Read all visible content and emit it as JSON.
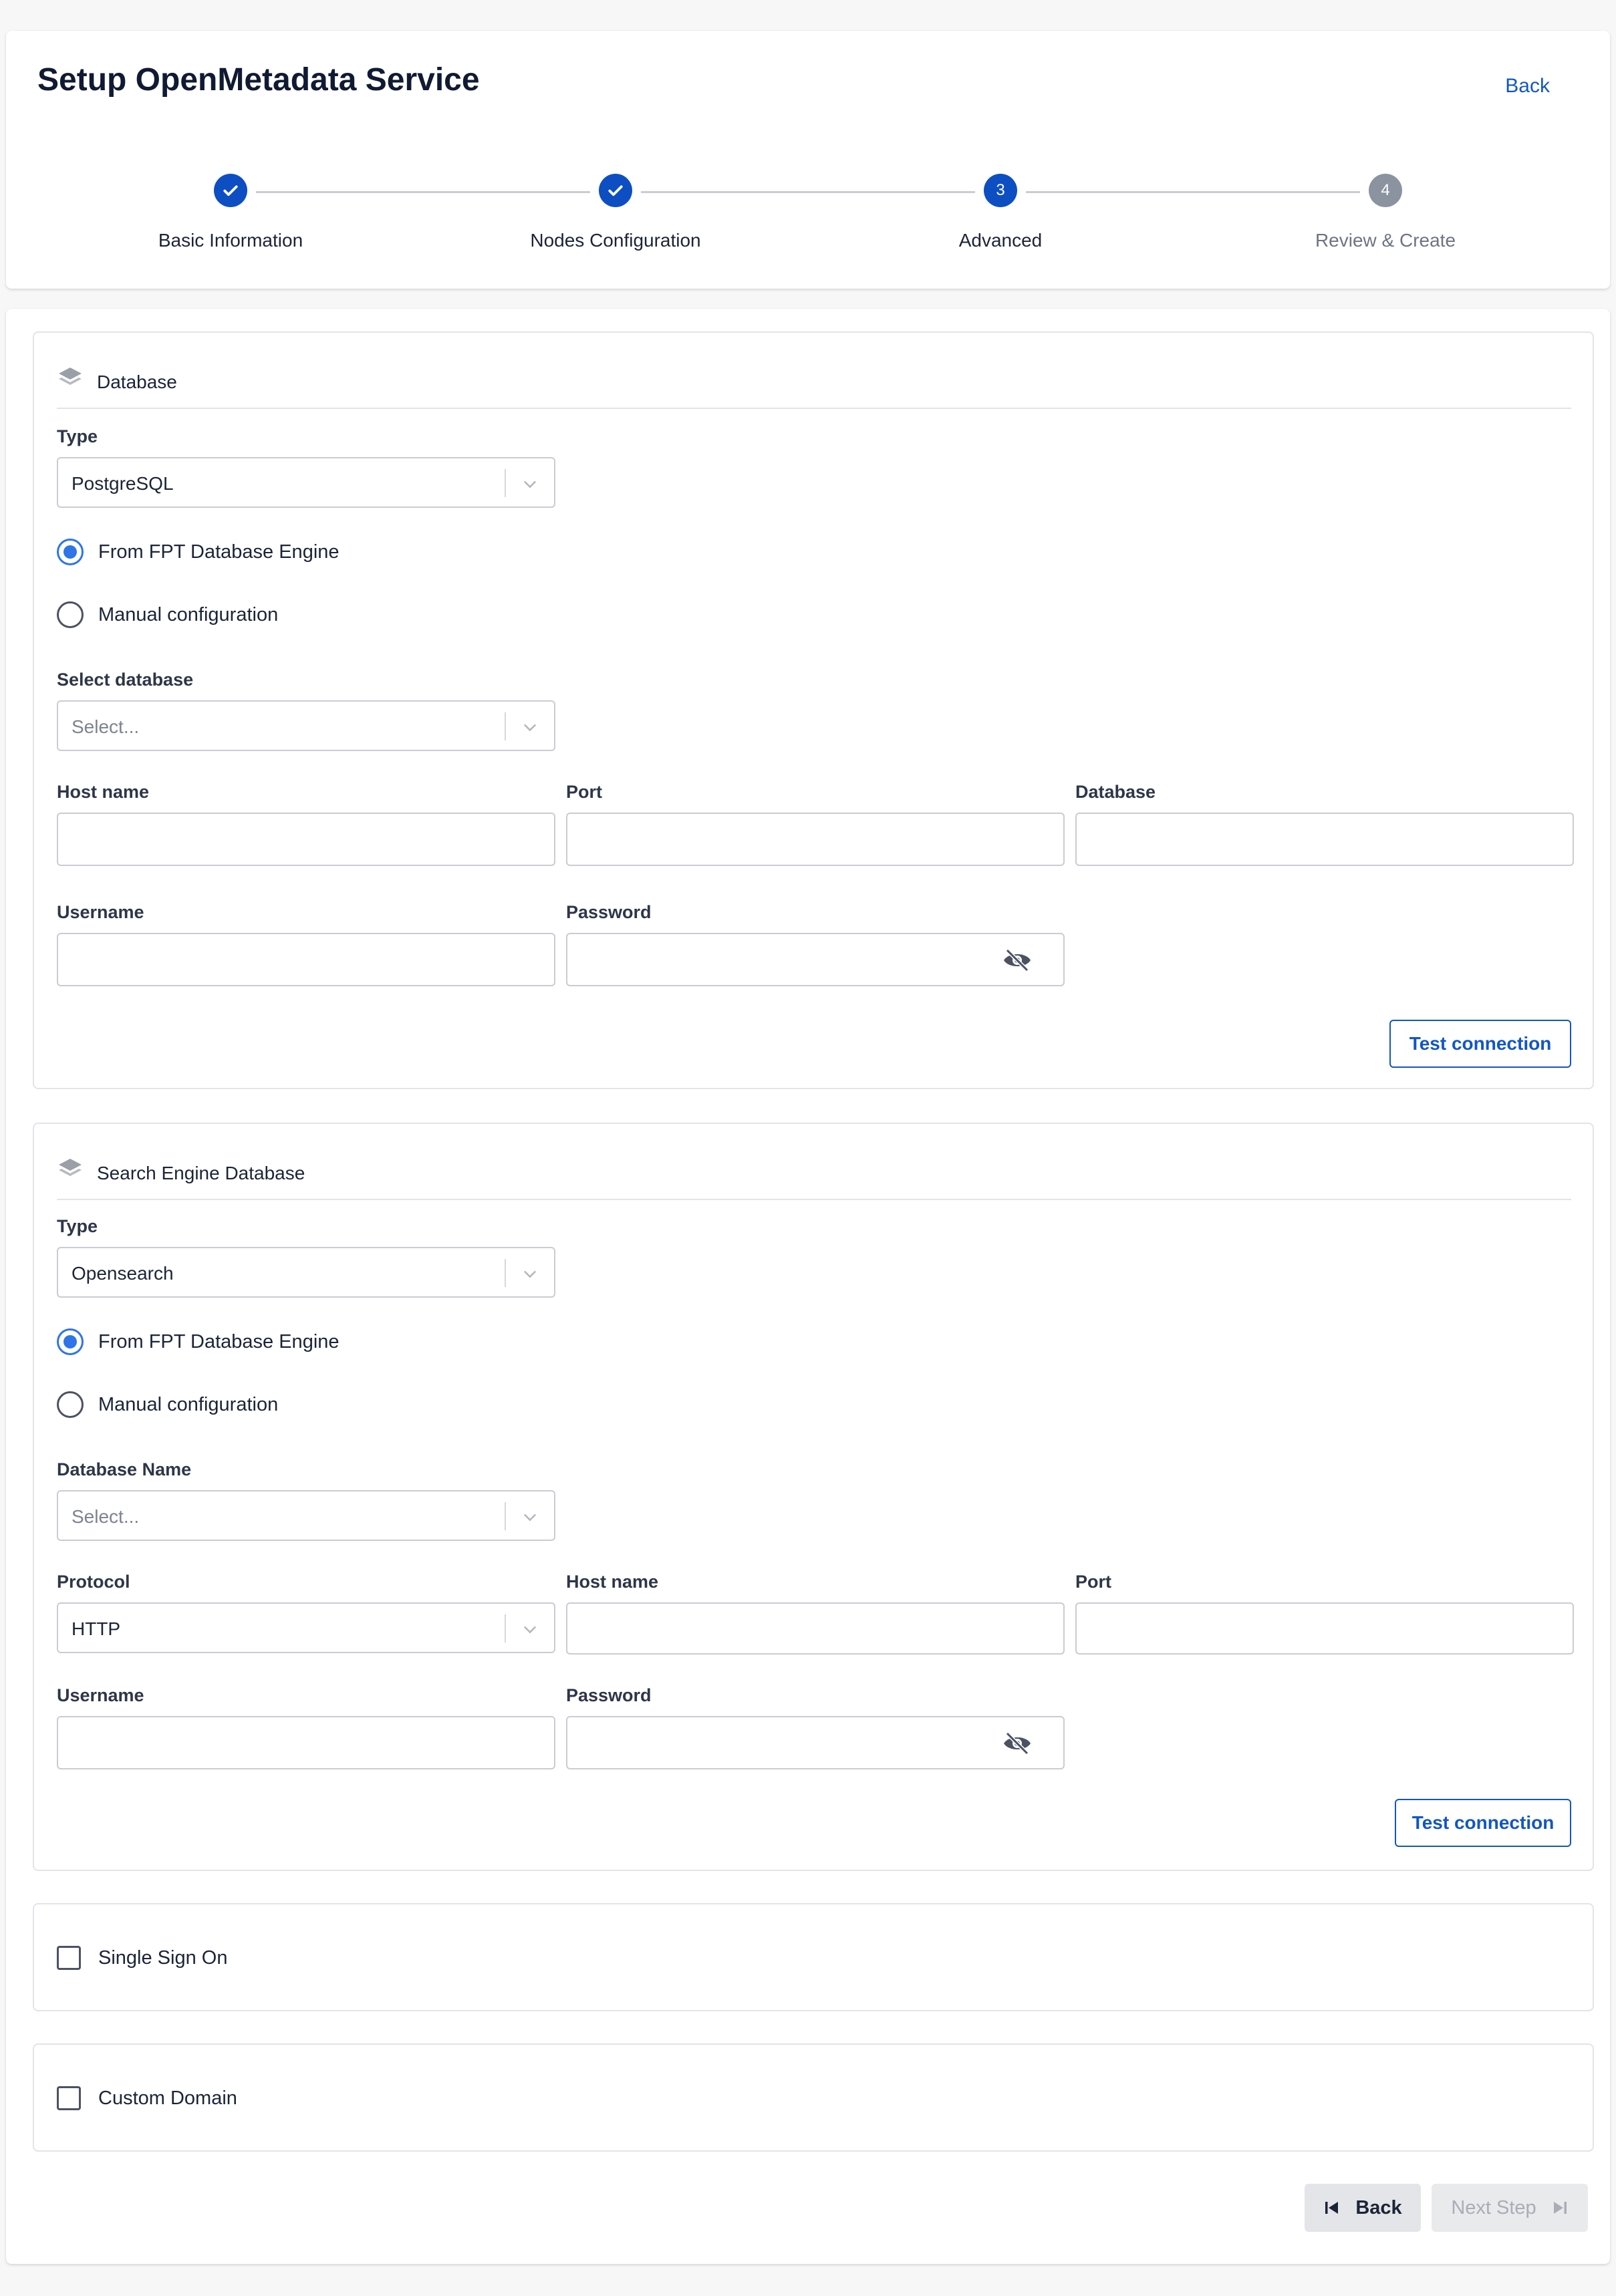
{
  "header": {
    "title": "Setup OpenMetadata Service",
    "back_label": "Back"
  },
  "stepper": {
    "steps": [
      {
        "number": "1",
        "label": "Basic Information",
        "state": "done"
      },
      {
        "number": "2",
        "label": "Nodes Configuration",
        "state": "done"
      },
      {
        "number": "3",
        "label": "Advanced",
        "state": "active"
      },
      {
        "number": "4",
        "label": "Review & Create",
        "state": "pending"
      }
    ]
  },
  "database": {
    "title": "Database",
    "type_label": "Type",
    "type_value": "PostgreSQL",
    "option_engine": "From FPT Database Engine",
    "option_manual": "Manual configuration",
    "selected_option": "engine",
    "select_db_label": "Select database",
    "select_db_placeholder": "Select...",
    "host_label": "Host name",
    "port_label": "Port",
    "database_label": "Database",
    "username_label": "Username",
    "password_label": "Password",
    "test_button": "Test connection"
  },
  "search": {
    "title": "Search Engine Database",
    "type_label": "Type",
    "type_value": "Opensearch",
    "option_engine": "From FPT Database Engine",
    "option_manual": "Manual configuration",
    "selected_option": "engine",
    "db_name_label": "Database Name",
    "db_name_placeholder": "Select...",
    "protocol_label": "Protocol",
    "protocol_value": "HTTP",
    "host_label": "Host name",
    "port_label": "Port",
    "username_label": "Username",
    "password_label": "Password",
    "test_button": "Test connection"
  },
  "sso": {
    "label": "Single Sign On",
    "checked": false
  },
  "custom_domain": {
    "label": "Custom Domain",
    "checked": false
  },
  "footer": {
    "back_label": "Back",
    "next_label": "Next Step"
  },
  "colors": {
    "primary": "#0d4fc2",
    "link": "#1356c4",
    "radio_selected": "#2f74e8",
    "step_pending": "#8b92a0"
  }
}
